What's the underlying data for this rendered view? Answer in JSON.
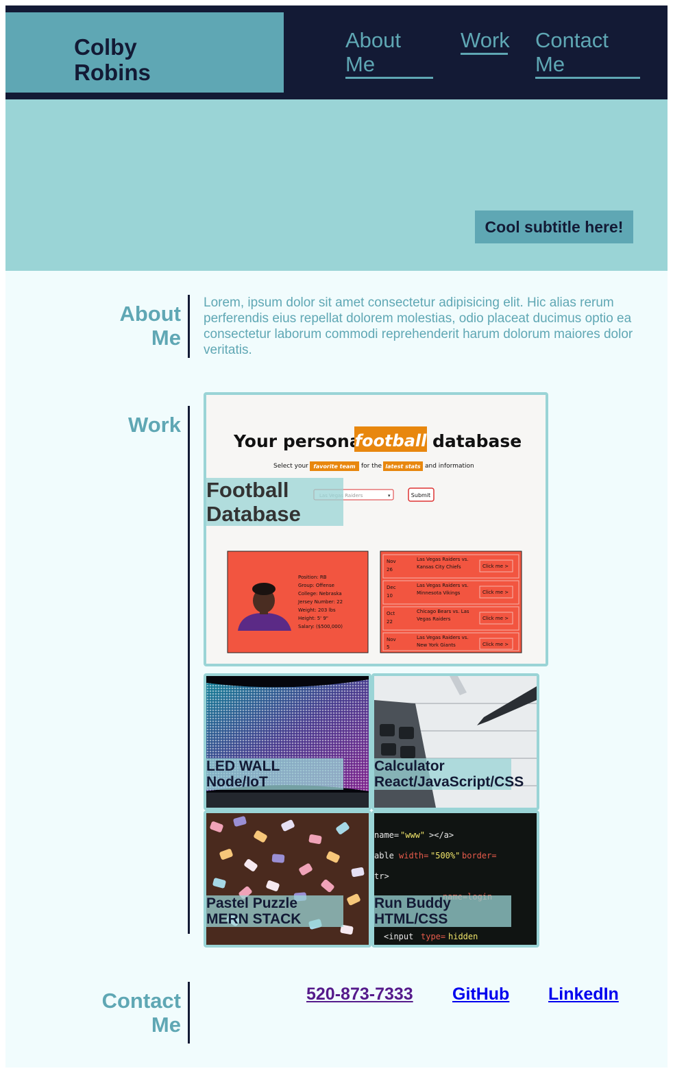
{
  "header": {
    "name": "Colby Robins",
    "nav": [
      "About Me",
      "Work",
      "Contact Me"
    ]
  },
  "hero": {
    "subtitle": "Cool subtitle here!"
  },
  "about": {
    "title": "About Me",
    "text": "Lorem, ipsum dolor sit amet consectetur adipisicing elit. Hic alias rerum perferendis eius repellat dolorem molestias, odio placeat ducimus optio ea consectetur laborum commodi reprehenderit harum dolorum maiores dolor veritatis."
  },
  "work": {
    "title": "Work",
    "featured": {
      "label": "Football Database",
      "screenshot": {
        "heading_pre": "Your personal",
        "heading_highlight": "football",
        "heading_post": "database",
        "sub_1": "Select your",
        "sub_hl_1": "favorite team",
        "sub_2": "for the",
        "sub_hl_2": "latest stats",
        "sub_3": "and information",
        "select_value": "Las Vegas Raiders",
        "submit_label": "Submit",
        "player_stats": [
          "Position: RB",
          "Group: Offense",
          "College: Nebraska",
          "Jersey Number: 22",
          "Weight: 203 lbs",
          "Height: 5' 9\"",
          "Salary: ($500,000)"
        ],
        "games": [
          {
            "date": [
              "Nov",
              "26"
            ],
            "matchup": [
              "Las Vegas Raiders vs.",
              "Kansas City Chiefs"
            ]
          },
          {
            "date": [
              "Dec",
              "10"
            ],
            "matchup": [
              "Las Vegas Raiders vs.",
              "Minnesota Vikings"
            ]
          },
          {
            "date": [
              "Oct",
              "22"
            ],
            "matchup": [
              "Chicago Bears vs. Las",
              "Vegas Raiders"
            ]
          },
          {
            "date": [
              "Nov",
              "5"
            ],
            "matchup": [
              "Las Vegas Raiders vs.",
              "New York Giants"
            ]
          }
        ],
        "game_button": "Click me >"
      }
    },
    "projects": [
      {
        "line1": "LED WALL",
        "line2": "Node/IoT"
      },
      {
        "line1": "Calculator",
        "line2": "React/JavaScript/CSS"
      },
      {
        "line1": "Pastel Puzzle",
        "line2": "MERN STACK"
      },
      {
        "line1": "Run Buddy",
        "line2": "HTML/CSS"
      }
    ]
  },
  "contact": {
    "title": "Contact Me",
    "phone": "520-873-7333",
    "github": "GitHub",
    "linkedin": "LinkedIn"
  },
  "colors": {
    "navy": "#131a35",
    "teal": "#5fa7b4",
    "light_teal": "#9ad4d6",
    "background": "#f1fcfd",
    "football_orange": "#e8870e",
    "football_card": "#f25540"
  }
}
